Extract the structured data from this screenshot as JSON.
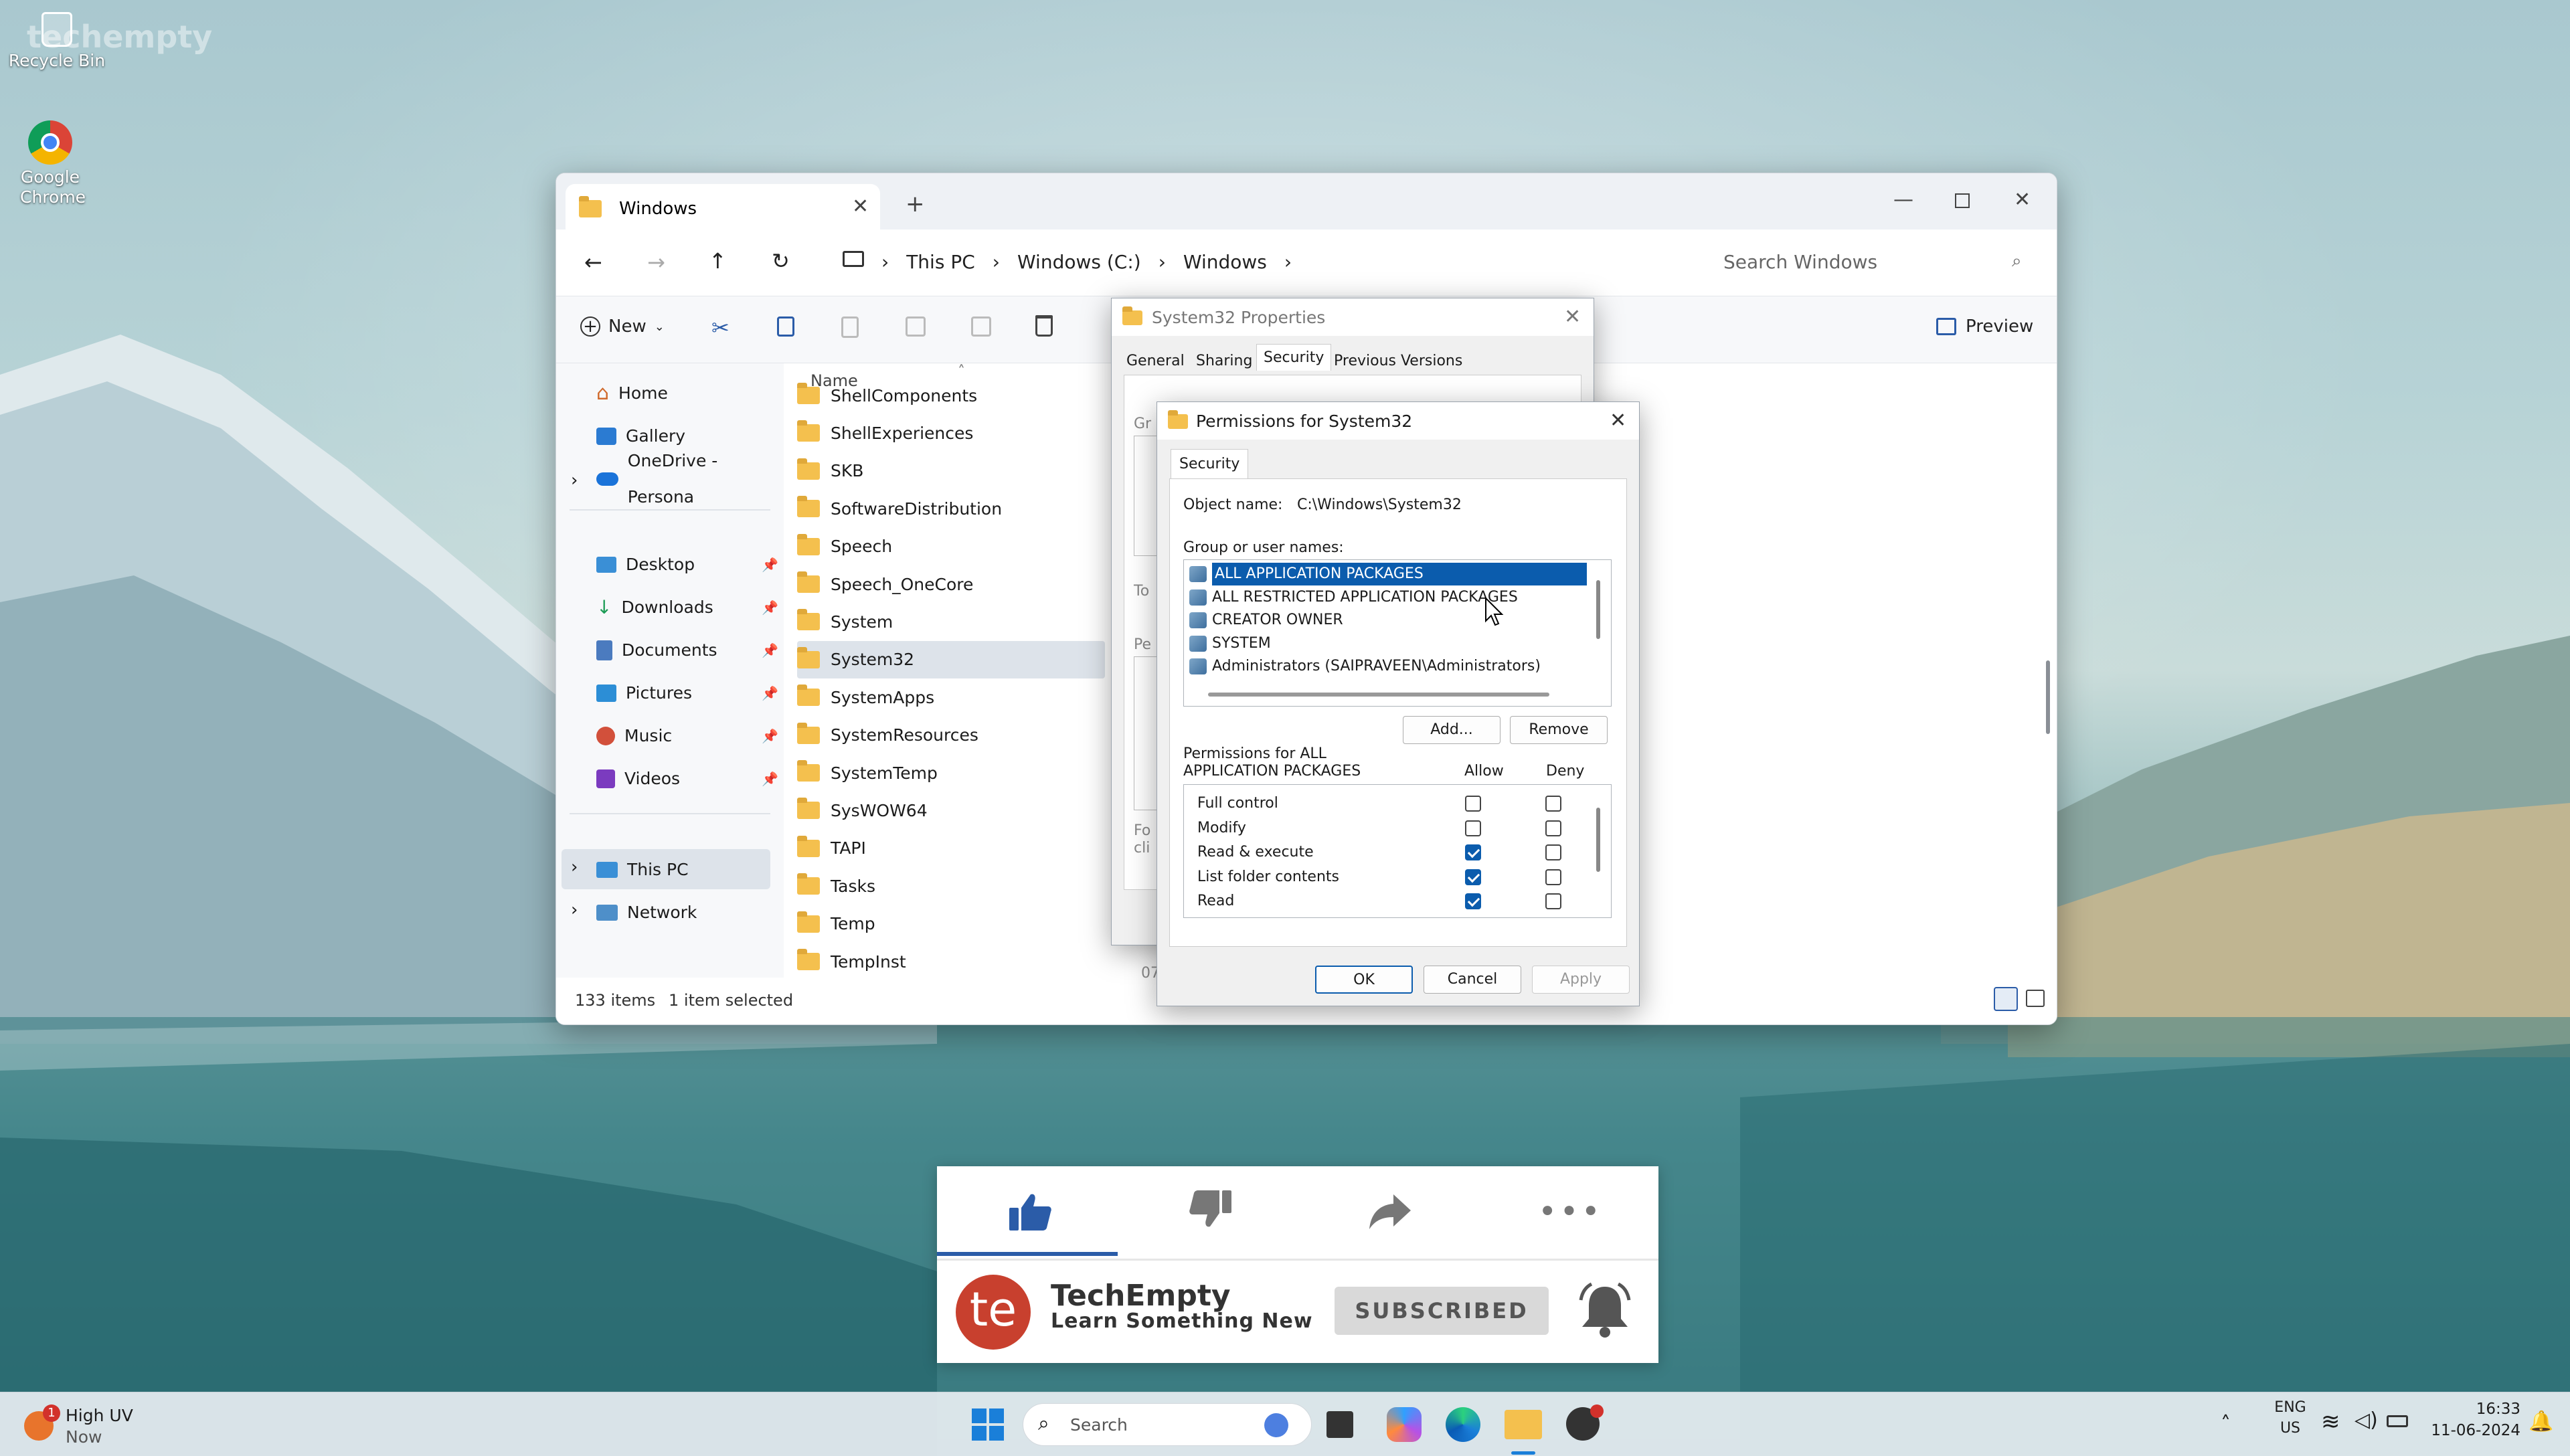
{
  "desktop": {
    "watermark": "techempty",
    "icons": [
      {
        "label": "Recycle Bin",
        "icon": "recycle-bin-icon"
      },
      {
        "label": "Google Chrome",
        "icon": "chrome-icon"
      }
    ]
  },
  "explorer": {
    "tab_title": "Windows",
    "breadcrumb": [
      "This PC",
      "Windows (C:)",
      "Windows"
    ],
    "search_placeholder": "Search Windows",
    "new_label": "New",
    "preview_label": "Preview",
    "column_name": "Name",
    "nav": {
      "top": [
        {
          "label": "Home",
          "icon": "home-icon"
        },
        {
          "label": "Gallery",
          "icon": "gallery-icon"
        },
        {
          "label": "OneDrive - Persona",
          "icon": "onedrive-icon"
        }
      ],
      "pinned": [
        {
          "label": "Desktop",
          "icon": "desktop-icon"
        },
        {
          "label": "Downloads",
          "icon": "downloads-icon"
        },
        {
          "label": "Documents",
          "icon": "documents-icon"
        },
        {
          "label": "Pictures",
          "icon": "pictures-icon"
        },
        {
          "label": "Music",
          "icon": "music-icon"
        },
        {
          "label": "Videos",
          "icon": "videos-icon"
        }
      ],
      "bottom": [
        {
          "label": "This PC",
          "icon": "this-pc-icon"
        },
        {
          "label": "Network",
          "icon": "network-icon"
        }
      ]
    },
    "files": [
      "ShellComponents",
      "ShellExperiences",
      "SKB",
      "SoftwareDistribution",
      "Speech",
      "Speech_OneCore",
      "System",
      "System32",
      "SystemApps",
      "SystemResources",
      "SystemTemp",
      "SysWOW64",
      "TAPI",
      "Tasks",
      "Temp",
      "TempInst"
    ],
    "selected_file": "System32",
    "status_items": "133 items",
    "status_selected": "1 item selected"
  },
  "properties": {
    "title": "System32 Properties",
    "tabs": [
      "General",
      "Sharing",
      "Security",
      "Previous Versions"
    ],
    "active_tab": "Security",
    "peek_labels": [
      "Gr",
      "To",
      "Pe",
      "Fo",
      "cli",
      "07"
    ]
  },
  "permissions": {
    "title": "Permissions for System32",
    "tab": "Security",
    "object_label": "Object name:",
    "object_value": "C:\\Windows\\System32",
    "group_label": "Group or user names:",
    "users": [
      "ALL APPLICATION PACKAGES",
      "ALL RESTRICTED APPLICATION PACKAGES",
      "CREATOR OWNER",
      "SYSTEM",
      "Administrators (SAIPRAVEEN\\Administrators)"
    ],
    "selected_user": "ALL APPLICATION PACKAGES",
    "add_label": "Add...",
    "remove_label": "Remove",
    "perm_heading_line1": "Permissions for ALL",
    "perm_heading_line2": "APPLICATION PACKAGES",
    "allow_label": "Allow",
    "deny_label": "Deny",
    "perms": [
      {
        "name": "Full control",
        "allow": false,
        "deny": false
      },
      {
        "name": "Modify",
        "allow": false,
        "deny": false
      },
      {
        "name": "Read & execute",
        "allow": true,
        "deny": false
      },
      {
        "name": "List folder contents",
        "allow": true,
        "deny": false
      },
      {
        "name": "Read",
        "allow": true,
        "deny": false
      }
    ],
    "ok_label": "OK",
    "cancel_label": "Cancel",
    "apply_label": "Apply"
  },
  "youtube": {
    "channel_name": "TechEmpty",
    "tagline": "Learn Something New",
    "subscribed_label": "SUBSCRIBED",
    "logo_text": "te",
    "accent": "#2b5ca8",
    "logo_color": "#c8402e"
  },
  "taskbar": {
    "weather_title": "High UV",
    "weather_sub": "Now",
    "weather_badge": "1",
    "search_placeholder": "Search",
    "lang_top": "ENG",
    "lang_bottom": "US",
    "time": "16:33",
    "date": "11-06-2024"
  }
}
